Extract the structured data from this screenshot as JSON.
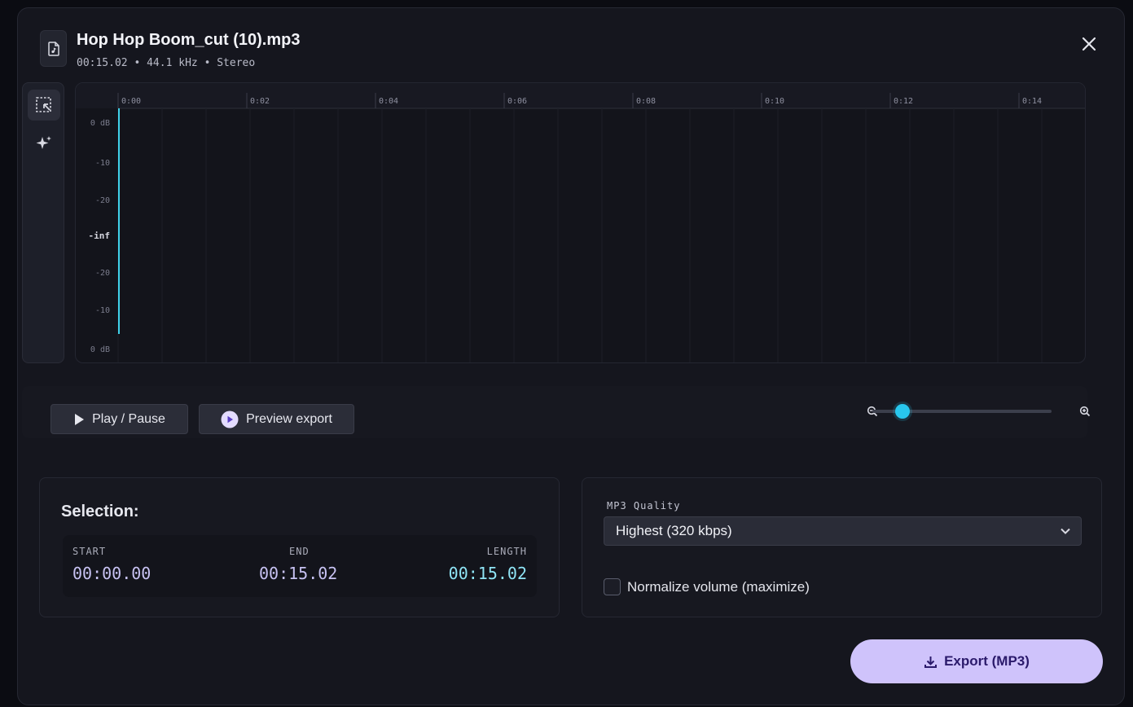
{
  "file": {
    "name": "Hop Hop Boom_cut (10).mp3",
    "duration": "00:15.02",
    "sample_rate": "44.1 kHz",
    "channels": "Stereo"
  },
  "tools": [
    {
      "name": "select-tool",
      "icon": "selection-icon",
      "active": true
    },
    {
      "name": "ai-tool",
      "icon": "sparkle-icon",
      "active": false
    }
  ],
  "timeline": {
    "ticks": [
      "0:00",
      "0:02",
      "0:04",
      "0:06",
      "0:08",
      "0:10",
      "0:12",
      "0:14"
    ],
    "db_labels": [
      "0 dB",
      "-10",
      "-20",
      "-inf",
      "-20",
      "-10",
      "0 dB"
    ]
  },
  "controls": {
    "play_label": "Play / Pause",
    "preview_label": "Preview export",
    "zoom_level": 0.1
  },
  "selection": {
    "title": "Selection:",
    "start_label": "START",
    "start": "00:00.00",
    "end_label": "END",
    "end": "00:15.02",
    "length_label": "LENGTH",
    "length": "00:15.02"
  },
  "export": {
    "quality_label": "MP3 Quality",
    "quality_value": "Highest (320 kbps)",
    "normalize_label": "Normalize volume (maximize)",
    "normalize_checked": false,
    "export_label": "Export (MP3)"
  },
  "colors": {
    "accent": "#28c7ee",
    "wave_top": "#b6aef0",
    "wave_bottom": "#5ed3e6",
    "export_bg": "#cfc3fb",
    "export_text": "#2b1a6b",
    "start_value": "#c7c2f2",
    "end_value": "#c7c2f2",
    "length_value": "#8fe4f5"
  }
}
